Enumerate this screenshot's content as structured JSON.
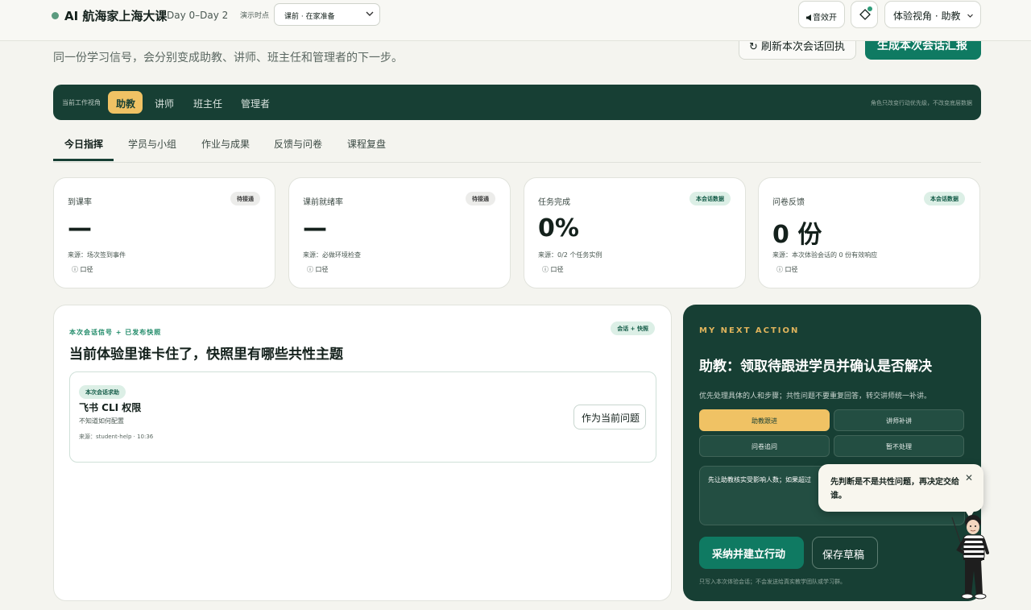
{
  "header": {
    "title": "AI 航海家上海大课",
    "subtitle": "Day 0–Day 2",
    "demo_label": "演示时点",
    "demo_select_value": "课前 · 在家准备",
    "sound_button": "音效开",
    "role_button": "体验视角 · 助教"
  },
  "page": {
    "subtitle": "同一份学习信号，会分别变成助教、讲师、班主任和管理者的下一步。",
    "refresh_button": "刷新本次会话回执",
    "generate_button": "生成本次会话汇报"
  },
  "rolebar": {
    "label": "当前工作视角",
    "roles": [
      "助教",
      "讲师",
      "班主任",
      "管理者"
    ],
    "active_role": "助教",
    "note": "角色只改变行动优先级，不改变底层数据"
  },
  "tabs": {
    "items": [
      "今日指挥",
      "学员与小组",
      "作业与成果",
      "反馈与问卷",
      "课程复盘"
    ],
    "active": "今日指挥"
  },
  "stats": [
    {
      "title": "到课率",
      "badge": "待接通",
      "value": "—",
      "source": "来源：场次签到事件",
      "metric": "ⓘ 口径"
    },
    {
      "title": "课前就绪率",
      "badge": "待接通",
      "value": "—",
      "source": "来源：必做环境检查",
      "metric": "ⓘ 口径"
    },
    {
      "title": "任务完成",
      "badge": "本会话数据",
      "value": "0%",
      "source": "来源：0/2 个任务实例",
      "metric": "ⓘ 口径"
    },
    {
      "title": "问卷反馈",
      "badge": "本会话数据",
      "value": "0 份",
      "source": "来源：本次体验会话的 0 份有效响应",
      "metric": "ⓘ 口径"
    }
  ],
  "signals": {
    "kicker": "本次会话信号 + 已发布快照",
    "title": "当前体验里谁卡住了，快照里有哪些共性主题",
    "badge": "会话 + 快照",
    "item": {
      "badge": "本次会话求助",
      "title": "飞书 CLI 权限",
      "desc": "不知道如何配置",
      "meta": "来源：student-help · 10:36",
      "button": "作为当前问题"
    }
  },
  "next_action": {
    "kicker": "MY NEXT ACTION",
    "title": "助教：领取待跟进学员并确认是否解决",
    "desc": "优先处理具体的人和步骤；共性问题不要重复回答，转交讲师统一补讲。",
    "options": [
      "助教跟进",
      "讲师补讲",
      "问卷追问",
      "暂不处理"
    ],
    "selected_option": "助教跟进",
    "textarea_value": "先让助教核实受影响人数；如果超过",
    "adopt_button": "采纳并建立行动",
    "draft_button": "保存草稿",
    "footnote": "只写入本次体验会话；不会发送给真实教学团队或学习群。"
  },
  "tooltip": {
    "text": "先判断是不是共性问题，再决定交给谁。",
    "close": "✕"
  },
  "colors": {
    "brand_dark": "#173f34",
    "accent_green": "#0f7a62",
    "accent_gold": "#f0c264",
    "badge_green_bg": "#dcefe6"
  }
}
